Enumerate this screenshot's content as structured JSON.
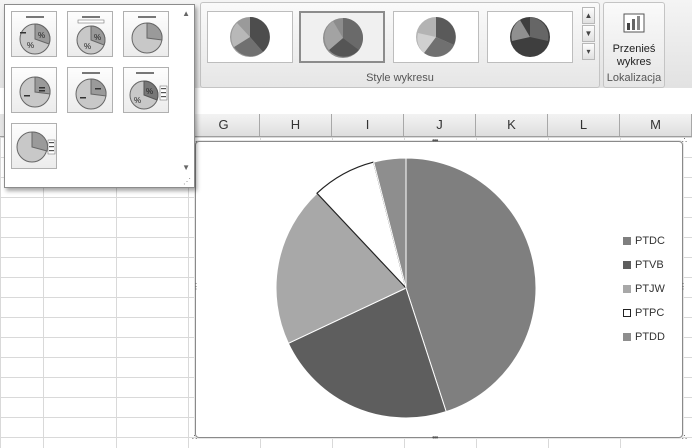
{
  "ribbon": {
    "styles_group_label": "Style wykresu",
    "location_group_label": "Lokalizacja",
    "move_chart_label_line1": "Przenieś",
    "move_chart_label_line2": "wykres",
    "scroll_up": "▲",
    "scroll_down": "▼",
    "scroll_more": "▾"
  },
  "dropdown": {
    "scroll_up": "▲",
    "scroll_down": "▼",
    "grip": "⋰"
  },
  "columns": [
    "G",
    "H",
    "I",
    "J",
    "K",
    "L",
    "M"
  ],
  "chart_data": {
    "type": "pie",
    "categories": [
      "PTDC",
      "PTVB",
      "PTJW",
      "PTPC",
      "PTDD"
    ],
    "values": [
      45,
      23,
      20,
      8,
      4
    ],
    "colors": [
      "#7f7f7f",
      "#5e5e5e",
      "#a8a8a8",
      "#ffffff",
      "#8e8e8e"
    ],
    "legend_position": "right"
  }
}
